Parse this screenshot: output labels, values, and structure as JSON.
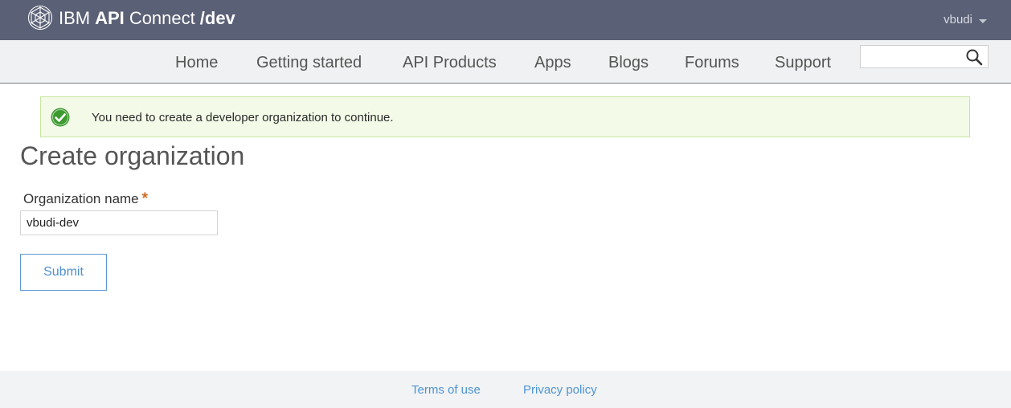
{
  "header": {
    "brand": {
      "part1": "IBM",
      "part2": "API",
      "part3": "Connect",
      "part4": "/dev"
    },
    "user": {
      "name": "vbudi"
    },
    "background_color": "#5a6075"
  },
  "nav": {
    "items": [
      {
        "label": "Home"
      },
      {
        "label": "Getting started"
      },
      {
        "label": "API Products"
      },
      {
        "label": "Apps"
      },
      {
        "label": "Blogs"
      },
      {
        "label": "Forums"
      },
      {
        "label": "Support"
      }
    ],
    "search": {
      "value": "",
      "icon": "search-icon"
    }
  },
  "alert": {
    "icon": "check-circle-icon",
    "message": "You need to create a developer organization to continue.",
    "status_color": "#3c9a2f"
  },
  "form": {
    "title": "Create organization",
    "field_label": "Organization name",
    "required_marker": "*",
    "field_value": "vbudi-dev",
    "submit_label": "Submit"
  },
  "footer": {
    "links": [
      {
        "label": "Terms of use"
      },
      {
        "label": "Privacy policy"
      }
    ]
  },
  "colors": {
    "accent": "#4e8fd0",
    "required": "#d06a1c"
  }
}
